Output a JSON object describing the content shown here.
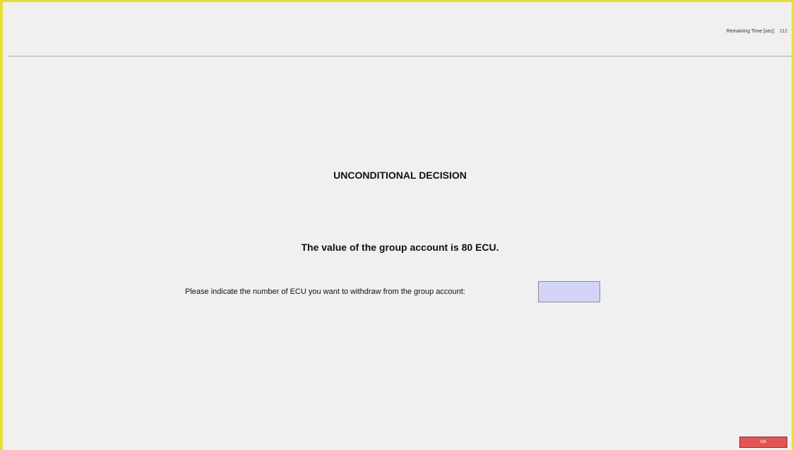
{
  "header": {
    "timer_label": "Remaining Time [sec]:",
    "timer_value": "112"
  },
  "main": {
    "title": "UNCONDITIONAL DECISION",
    "group_value_text": "The value of the group account is 80 ECU.",
    "prompt": "Please indicate the number of ECU you want to withdraw from the group account:",
    "withdraw_input": {
      "value": "",
      "placeholder": ""
    }
  },
  "footer": {
    "ok_label": "OK"
  },
  "colors": {
    "frame_accent": "#e8de3a",
    "background": "#f0f0f0",
    "input_fill": "#d4d4fb",
    "ok_button": "#e25555",
    "timer_value": "#d01818"
  }
}
